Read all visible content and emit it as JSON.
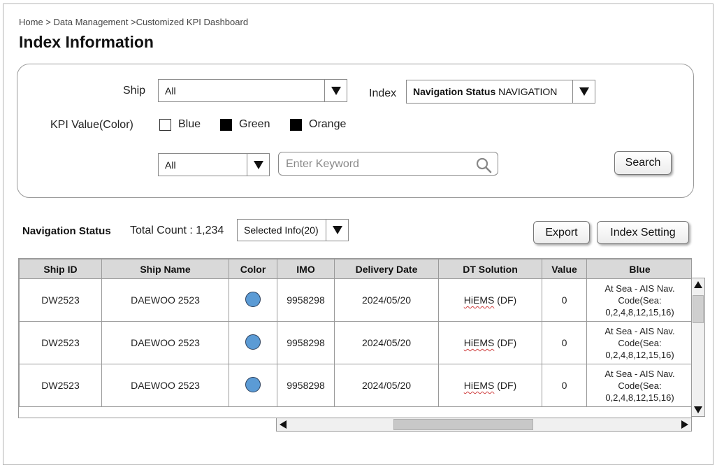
{
  "breadcrumb": "Home > Data Management >Customized KPI Dashboard",
  "page_title": "Index Information",
  "filters": {
    "ship_label": "Ship",
    "ship_value": "All",
    "index_label": "Index",
    "index_value_bold": "Navigation Status",
    "index_value_rest": "NAVIGATION",
    "kpi_label": "KPI Value(Color)",
    "kpi_options": [
      {
        "label": "Blue",
        "checked": false
      },
      {
        "label": "Green",
        "checked": true
      },
      {
        "label": "Orange",
        "checked": true
      }
    ],
    "category_value": "All",
    "keyword_placeholder": "Enter Keyword",
    "search_button": "Search"
  },
  "results": {
    "section_title": "Navigation Status",
    "total_count": "Total Count : 1,234",
    "selected_info": "Selected Info(20)",
    "export_button": "Export",
    "index_setting_button": "Index Setting"
  },
  "table": {
    "columns": [
      "Ship ID",
      "Ship Name",
      "Color",
      "IMO",
      "Delivery Date",
      "DT Solution",
      "Value",
      "Blue"
    ],
    "rows": [
      {
        "ship_id": "DW2523",
        "ship_name": "DAEWOO 2523",
        "color": "#5b9bd5",
        "imo": "9958298",
        "delivery_date": "2024/05/20",
        "dt_solution_a": "HiEMS",
        "dt_solution_b": "(DF)",
        "value": "0",
        "blue_1": "At Sea - AIS Nav.",
        "blue_2": "Code(Sea:",
        "blue_3": "0,2,4,8,12,15,16)"
      },
      {
        "ship_id": "DW2523",
        "ship_name": "DAEWOO 2523",
        "color": "#5b9bd5",
        "imo": "9958298",
        "delivery_date": "2024/05/20",
        "dt_solution_a": "HiEMS",
        "dt_solution_b": "(DF)",
        "value": "0",
        "blue_1": "At Sea - AIS Nav.",
        "blue_2": "Code(Sea:",
        "blue_3": "0,2,4,8,12,15,16)"
      },
      {
        "ship_id": "DW2523",
        "ship_name": "DAEWOO 2523",
        "color": "#5b9bd5",
        "imo": "9958298",
        "delivery_date": "2024/05/20",
        "dt_solution_a": "HiEMS",
        "dt_solution_b": "(DF)",
        "value": "0",
        "blue_1": "At Sea - AIS Nav.",
        "blue_2": "Code(Sea:",
        "blue_3": "0,2,4,8,12,15,16)"
      }
    ]
  }
}
